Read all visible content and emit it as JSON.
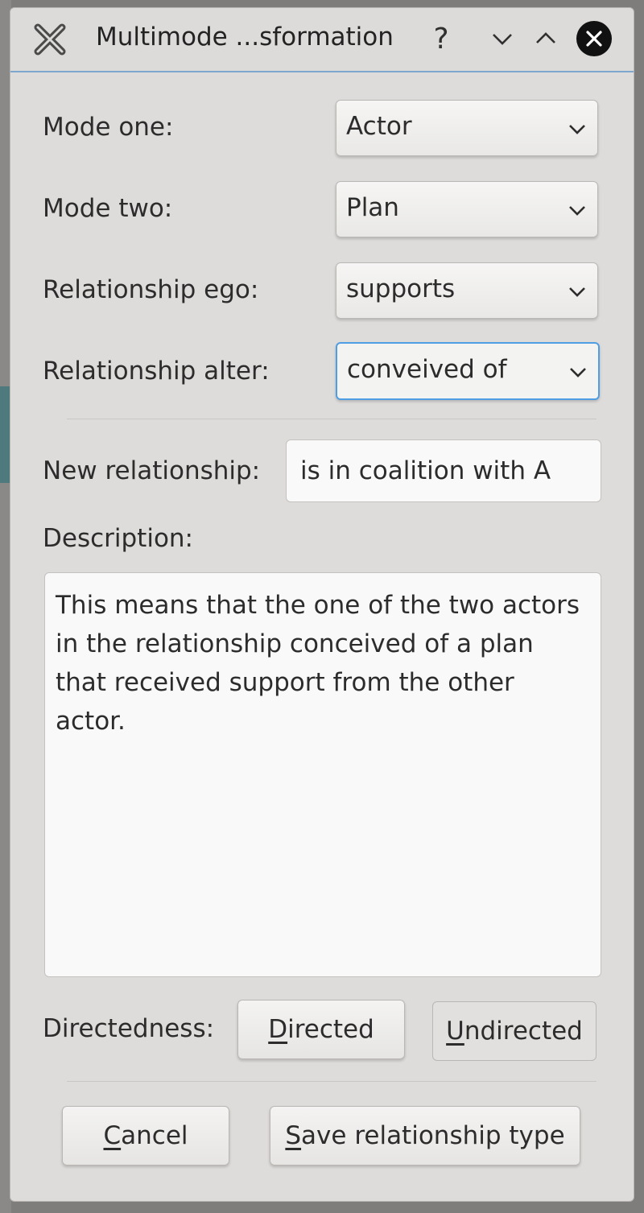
{
  "window": {
    "title": "Multimode ...sformation",
    "help_glyph": "?",
    "icons": {
      "app": "xcross-app-icon",
      "help": "question-icon",
      "minimize": "chevron-down-icon",
      "maximize": "chevron-up-icon",
      "close": "close-circle-icon"
    }
  },
  "form": {
    "mode_one": {
      "label": "Mode one:",
      "value": "Actor"
    },
    "mode_two": {
      "label": "Mode two:",
      "value": "Plan"
    },
    "relationship_ego": {
      "label": "Relationship ego:",
      "value": "supports"
    },
    "relationship_alter": {
      "label": "Relationship alter:",
      "value": "conveived of"
    },
    "new_relationship": {
      "label": "New relationship:",
      "value": "is in coalition with A"
    },
    "description": {
      "label": "Description:",
      "value": "This means that the one of the two actors in the relationship conceived of a plan that received support from the other actor."
    },
    "directedness": {
      "label": "Directedness:",
      "directed": {
        "mnemonic": "D",
        "rest": "irected"
      },
      "undirected": {
        "mnemonic": "U",
        "rest": "ndirected"
      }
    }
  },
  "buttons": {
    "cancel": {
      "mnemonic": "C",
      "rest": "ancel"
    },
    "save": {
      "mnemonic": "S",
      "rest": "ave relationship type"
    }
  },
  "colors": {
    "focus_accent": "#4f9ee3",
    "title_underline": "#7da7cf",
    "window_bg": "#dedcda"
  }
}
